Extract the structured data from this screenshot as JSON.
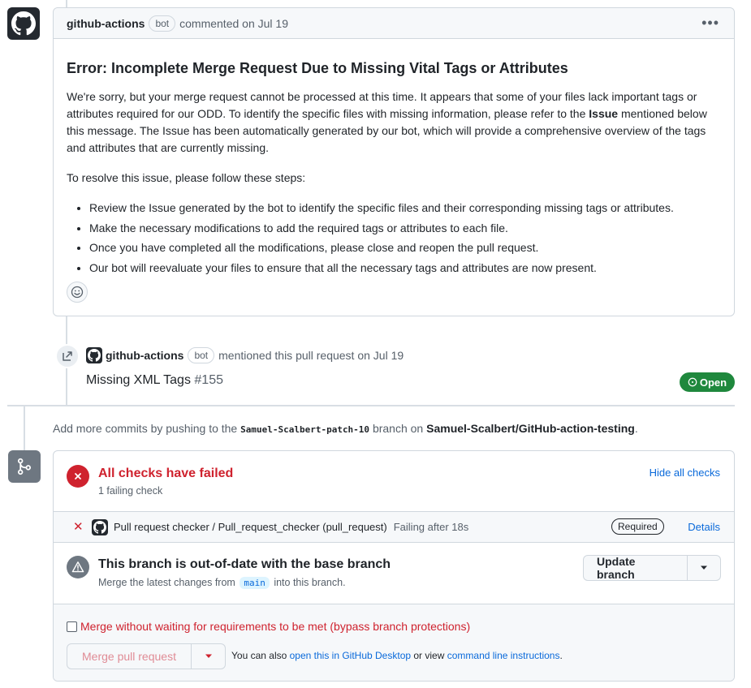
{
  "comment": {
    "author": "github-actions",
    "badge": "bot",
    "meta": "commented on Jul 19",
    "menu_icon": "kebab-horizontal-icon",
    "title": "Error: Incomplete Merge Request Due to Missing Vital Tags or Attributes",
    "para1_before": "We're sorry, but your merge request cannot be processed at this time. It appears that some of your files lack important tags or attributes required for our ODD. To identify the specific files with missing information, please refer to the ",
    "para1_bold": "Issue",
    "para1_after": " mentioned below this message. The Issue has been automatically generated by our bot, which will provide a comprehensive overview of the tags and attributes that are currently missing.",
    "para2": "To resolve this issue, please follow these steps:",
    "steps": [
      "Review the Issue generated by the bot to identify the specific files and their corresponding missing tags or attributes.",
      "Make the necessary modifications to add the required tags or attributes to each file.",
      "Once you have completed all the modifications, please close and reopen the pull request.",
      "Our bot will reevaluate your files to ensure that all the necessary tags and attributes are now present."
    ]
  },
  "mention": {
    "author": "github-actions",
    "badge": "bot",
    "meta": "mentioned this pull request on Jul 19",
    "issue_title": "Missing XML Tags",
    "issue_number": "#155",
    "status": "Open"
  },
  "push_note": {
    "prefix": "Add more commits by pushing to the ",
    "branch": "Samuel-Scalbert-patch-10",
    "middle": " branch on ",
    "repo": "Samuel-Scalbert/GitHub-action-testing",
    "suffix": "."
  },
  "merge_box": {
    "checks": {
      "title": "All checks have failed",
      "subtitle": "1 failing check",
      "hide_link": "Hide all checks"
    },
    "check_row": {
      "name": "Pull request checker / Pull_request_checker (pull_request)",
      "status": "Failing after 18s",
      "required": "Required",
      "details": "Details"
    },
    "branch": {
      "title": "This branch is out-of-date with the base branch",
      "sub_before": "Merge the latest changes from",
      "base_branch": "main",
      "sub_after": "into this branch.",
      "update_button": "Update branch"
    },
    "merge": {
      "bypass_label": "Merge without waiting for requirements to be met (bypass branch protections)",
      "bypass_checked": false,
      "merge_button": "Merge pull request",
      "hint_prefix": "You can also ",
      "desktop_link": "open this in GitHub Desktop",
      "hint_middle": " or view ",
      "cli_link": "command line instructions",
      "hint_suffix": "."
    }
  },
  "colors": {
    "danger": "#cf222e",
    "success": "#1f883d",
    "link": "#0969da",
    "muted": "#57606a"
  }
}
